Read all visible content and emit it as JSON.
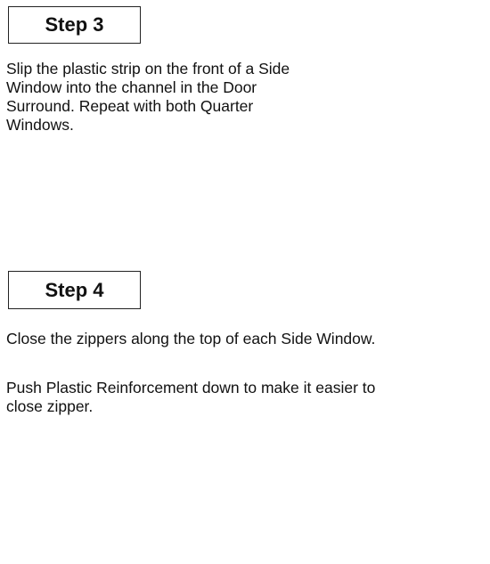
{
  "steps": [
    {
      "title": "Step 3",
      "paragraphs": [
        "Slip the plastic strip on the front of a Side Window into the channel in the Door Surround. Repeat with both Quarter Windows."
      ]
    },
    {
      "title": "Step 4",
      "paragraphs": [
        "Close the zippers along the top of each Side Window.",
        "Push Plastic Reinforcement down to make it easier to close zipper."
      ]
    }
  ]
}
